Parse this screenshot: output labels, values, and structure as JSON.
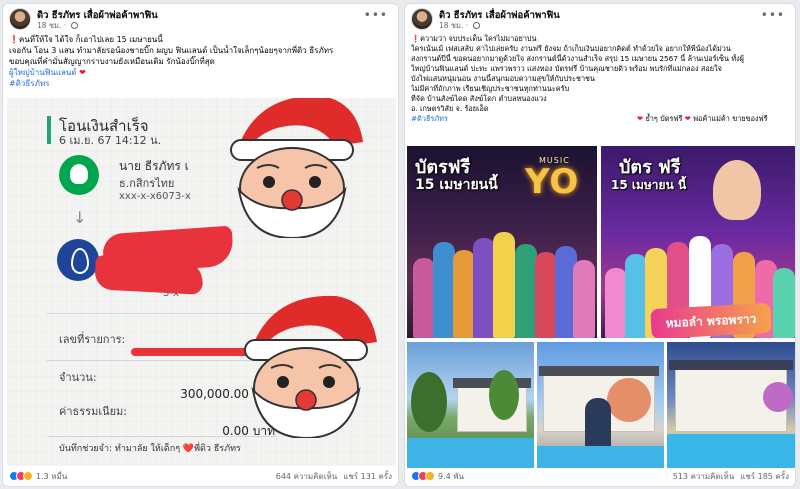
{
  "posts": [
    {
      "author": "ดิว ธีรภัทร เสื่อผ้าพ่อค้าพาฟิน",
      "time": "18 ชม.",
      "text_lines": [
        "คนที่ให้ใจ ได้ใจ ก็เอาไปเลย 15 เมษายนนี้",
        "เจอกัน โอน 3 แสน ทำมาลัยรอน้องชายบิ๊ก ผญบ ฟินแลนด์ เป็นน้ำใจเล็กๆน้อยๆจากพี่ดิว ธีรภัทร",
        "ขอบคุณที่คำมั่นสัญญากราบงามยังเหมือนเดิม รักน้องบิ๊กที่สุด"
      ],
      "text_link": "ผู้ใหญ่บ้านฟินแลนด์",
      "hashtag": "#ดิวธีรภัทร",
      "slip": {
        "title": "โอนเงินสำเร็จ",
        "datetime": "6 เม.ย. 67 14:12 น.",
        "sender_name": "นาย ธีรภัทร เ",
        "sender_bank": "ธ.กสิกรไทย",
        "sender_account": "xxx-x-x6073-x",
        "receiver_account": "3-x",
        "ref_label": "เลขที่รายการ:",
        "amount_label": "จำนวน:",
        "amount_value": "300,000.00 บาท",
        "fee_label": "ค่าธรรมเนียม:",
        "fee_value": "0.00 บาท",
        "memo": "บันทึกช่วยจำ: ทำมาลัย ให้เด็กๆ ❤️พี่ดิว ธีรภัทร"
      },
      "reactions_count": "1.3 หมื่น",
      "comments": "644 ความคิดเห็น",
      "shares": "แชร์ 131 ครั้ง"
    },
    {
      "author": "ดิว ธีรภัทร เสื่อผ้าพ่อค้าพาฟิน",
      "time": "18 ชม.",
      "text_lines": [
        "ความว่า จบประเด็น ใครไม่มาอย่าบ่น",
        "ใครเน้นเม้ เฟสเสลับ ค่าไปเล่ยครับ งานฟรี ยังจม ถ้าเก็บเงินบ่อยากคิดต์ ทำด้วยใจ อยากให้พี่น้องได้ม่วน",
        "สงกรานต์ปีนี้ ขอคนอยากมาดูด้วยใจ สงกรานต์นี้ด้วงานสำเร็จ สรุป 15 เมษายน 2567 นี้ ล้านเปอร์เซ็น ทั้งผู้",
        "ใหญ่บ้านฟินแลนด์ ปะทะ แพรวพราว แสงทอง บัตรฟรี บ้านคุณชายดิว พร้อม พบรักที่แม่กลอง สอยใจ",
        "บังไฟแสนหนุ่มนอน งานนี้สนุกมอบความสุขให้กับประชาชน",
        "ไม่มีค่าที่ถักภาพ เรียนเชิญประชาชนทุกท่านนะครับ",
        "ที่จัด บ้านสังฆ์ไดด สังฆ์โดก ตำบลหนองแวง",
        "อ. เกษตรวิสัย จ. ร้อยเอ็ด"
      ],
      "inline_text": "ย้ำๆ บัตรฟรี",
      "inline_text_2": "พ่อค้าแม่ค้า ขายของฟรี",
      "hashtag": "#ดิวธีรภัทร",
      "posters": [
        {
          "tag": "บัตรฟรี",
          "date": "15 เมษายนนี้",
          "title": "YO",
          "music": "MUSIC"
        },
        {
          "tag": "บัตร ฟรี",
          "date": "15 เมษายน นี้",
          "logo": "หมอลำ พรอพราว"
        }
      ],
      "reactions_count": "9.4 พัน",
      "comments": "513 ความคิดเห็น",
      "shares": "แชร์ 185 ครั้ง"
    }
  ]
}
